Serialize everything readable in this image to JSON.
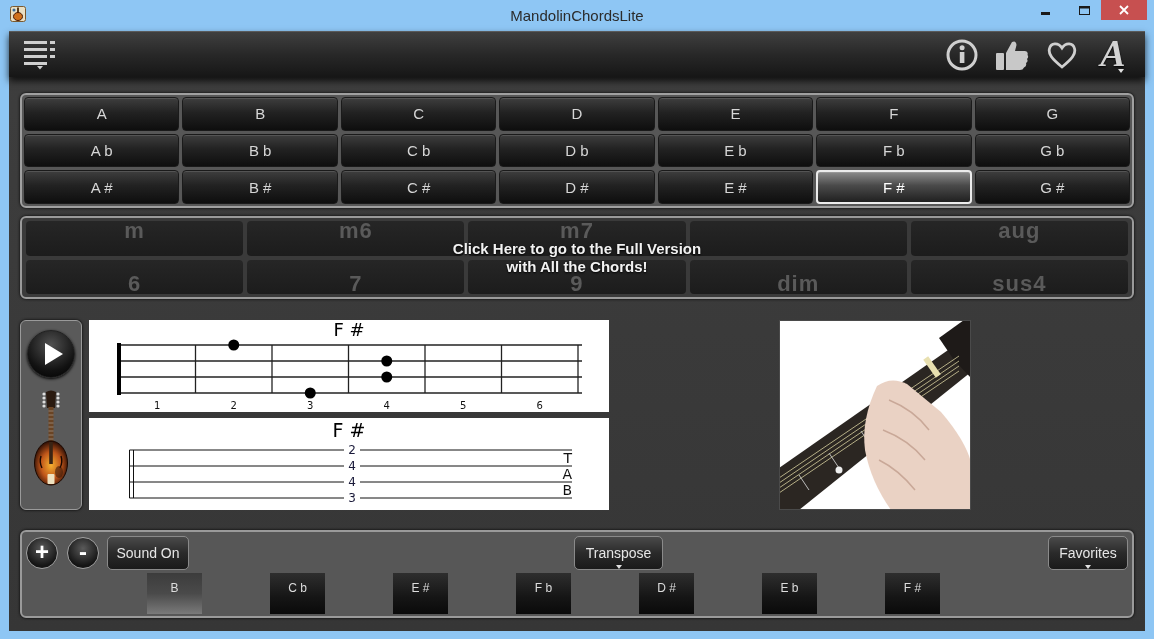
{
  "window": {
    "title": "MandolinChordsLite"
  },
  "toolbar": {
    "font_button": "A"
  },
  "root_chords": {
    "rows": [
      [
        {
          "label": "A",
          "selected": false
        },
        {
          "label": "B",
          "selected": false
        },
        {
          "label": "C",
          "selected": false
        },
        {
          "label": "D",
          "selected": false
        },
        {
          "label": "E",
          "selected": false
        },
        {
          "label": "F",
          "selected": false
        },
        {
          "label": "G",
          "selected": false
        }
      ],
      [
        {
          "label": "A b",
          "selected": false
        },
        {
          "label": "B b",
          "selected": false
        },
        {
          "label": "C b",
          "selected": false
        },
        {
          "label": "D b",
          "selected": false
        },
        {
          "label": "E b",
          "selected": false
        },
        {
          "label": "F b",
          "selected": false
        },
        {
          "label": "G b",
          "selected": false
        }
      ],
      [
        {
          "label": "A #",
          "selected": false
        },
        {
          "label": "B #",
          "selected": false
        },
        {
          "label": "C #",
          "selected": false
        },
        {
          "label": "D #",
          "selected": false
        },
        {
          "label": "E #",
          "selected": false
        },
        {
          "label": "F #",
          "selected": true
        },
        {
          "label": "G #",
          "selected": false
        }
      ]
    ]
  },
  "chord_types": {
    "disabled": true,
    "rows": [
      [
        {
          "kind": "label",
          "label": "m"
        },
        {
          "kind": "label",
          "label": "m6"
        },
        {
          "kind": "label",
          "label": "m7"
        },
        {
          "kind": "blank"
        },
        {
          "kind": "label",
          "label": "aug"
        }
      ],
      [
        {
          "kind": "label",
          "label": "6"
        },
        {
          "kind": "label",
          "label": "7"
        },
        {
          "kind": "label",
          "label": "9"
        },
        {
          "kind": "label",
          "label": "dim"
        },
        {
          "kind": "label",
          "label": "sus4"
        }
      ]
    ],
    "promo_lines": [
      "Click Here to go to the Full Version",
      "with All the Chords!"
    ]
  },
  "chord_diagram": {
    "title": "F #",
    "frets": [
      {
        "number": "1",
        "dots": [
          false,
          false,
          false,
          false
        ]
      },
      {
        "number": "2",
        "dots": [
          true,
          false,
          false,
          false
        ]
      },
      {
        "number": "3",
        "dots": [
          false,
          false,
          false,
          true
        ]
      },
      {
        "number": "4",
        "dots": [
          false,
          true,
          true,
          false
        ]
      },
      {
        "number": "5",
        "dots": [
          false,
          false,
          false,
          false
        ]
      },
      {
        "number": "6",
        "dots": [
          false,
          false,
          false,
          false
        ]
      }
    ]
  },
  "tablature": {
    "title": "F #",
    "notes": [
      "2",
      "4",
      "4",
      "3"
    ],
    "clef": [
      "T",
      "A",
      "B"
    ]
  },
  "controls": {
    "zoom_in": "+",
    "zoom_out": "-",
    "sound": "Sound On",
    "transpose": "Transpose",
    "favorites": "Favorites"
  },
  "history": [
    {
      "label": "B",
      "selected": true
    },
    {
      "label": "C b",
      "selected": false
    },
    {
      "label": "E #",
      "selected": false
    },
    {
      "label": "F b",
      "selected": false
    },
    {
      "label": "D #",
      "selected": false
    },
    {
      "label": "E b",
      "selected": false
    },
    {
      "label": "F #",
      "selected": false
    }
  ]
}
